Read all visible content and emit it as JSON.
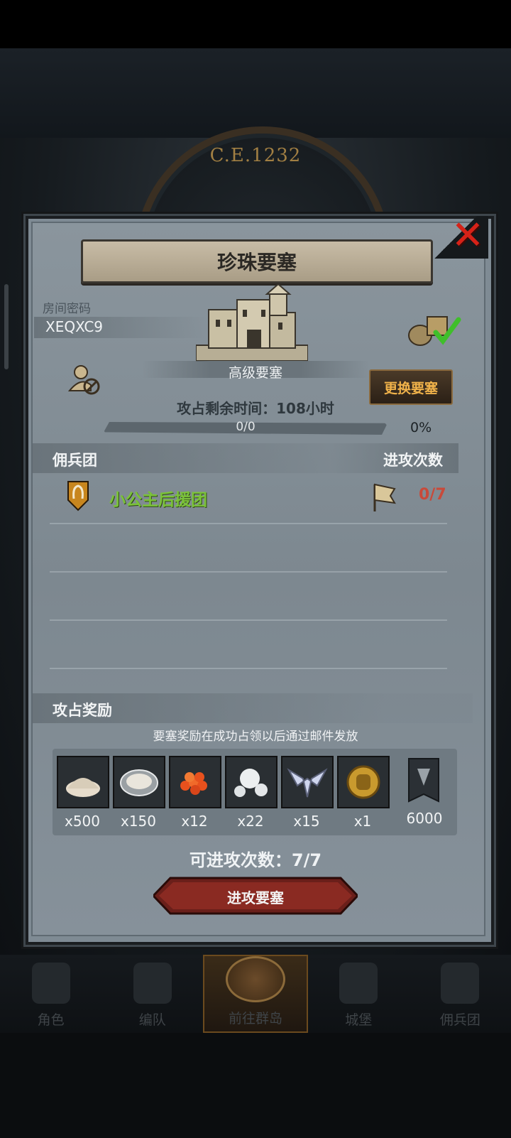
{
  "background": {
    "era": "C.E.1232"
  },
  "dialog": {
    "title": "珍珠要塞",
    "room_code_label": "房间密码",
    "room_code": "XEQXC9",
    "fort_type": "高级要塞",
    "swap_button": "更换要塞",
    "timer": "攻占剩余时间：108小时",
    "progress": {
      "text": "0/0",
      "percent": "0%",
      "fraction": 0
    },
    "mercenary_header": "佣兵团",
    "attack_count_header": "进攻次数",
    "guilds": [
      {
        "name": "小公主后援团",
        "count": "0/7"
      }
    ],
    "reward_header": "攻占奖励",
    "reward_note": "要塞奖励在成功占领以后通过邮件发放",
    "rewards": [
      {
        "icon": "salt-pile-icon",
        "qty": "x500"
      },
      {
        "icon": "oyster-icon",
        "qty": "x150"
      },
      {
        "icon": "fish-roe-icon",
        "qty": "x12"
      },
      {
        "icon": "pearls-icon",
        "qty": "x22"
      },
      {
        "icon": "winged-emblem-icon",
        "qty": "x15"
      },
      {
        "icon": "knight-medal-icon",
        "qty": "x1"
      },
      {
        "icon": "guild-banner-icon",
        "qty": "6000"
      }
    ],
    "attempts": "可进攻次数：7/7",
    "attack_button": "进攻要塞"
  },
  "nav": {
    "items": [
      {
        "label": "角色"
      },
      {
        "label": "编队"
      },
      {
        "label": "前往群岛"
      },
      {
        "label": "城堡"
      },
      {
        "label": "佣兵团"
      }
    ],
    "active_index": 2
  },
  "colors": {
    "guild_name": "#7bc23a",
    "count_red": "#c84a3a",
    "swap_text": "#f0b24a",
    "close_red": "#d62218"
  }
}
